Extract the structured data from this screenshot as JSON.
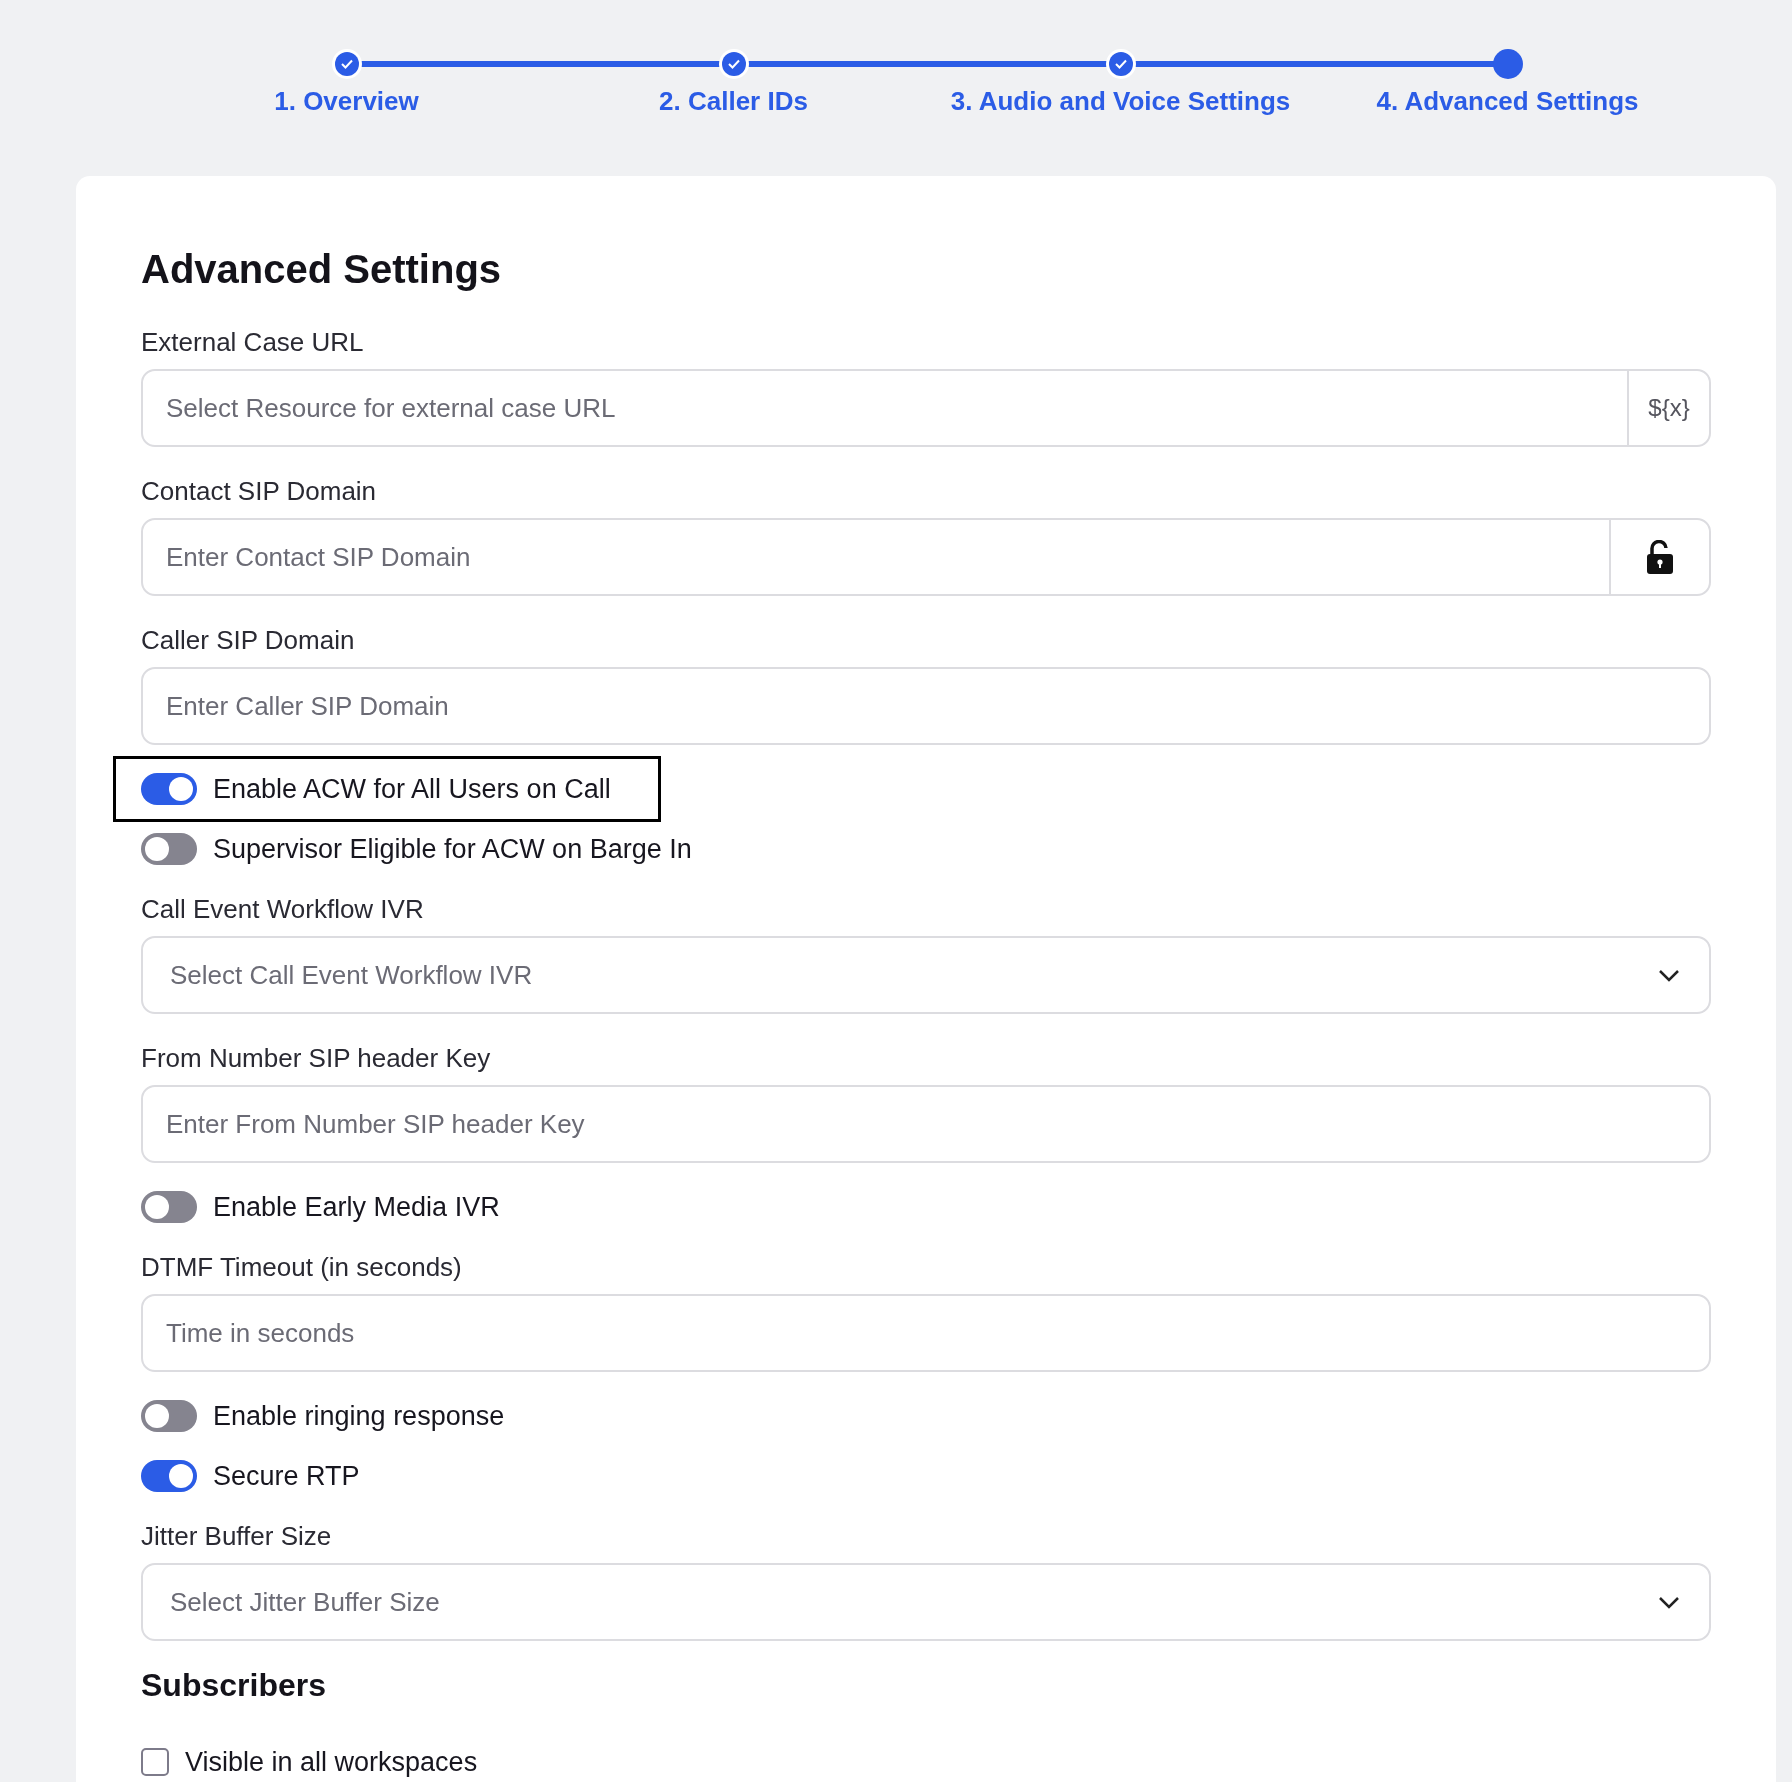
{
  "steps": [
    {
      "label": "1. Overview",
      "done": true,
      "selected": false
    },
    {
      "label": "2. Caller IDs",
      "done": true,
      "selected": false
    },
    {
      "label": "3. Audio and Voice Settings",
      "done": true,
      "selected": false
    },
    {
      "label": "4. Advanced Settings",
      "done": false,
      "selected": true
    }
  ],
  "title": "Advanced Settings",
  "fields": [
    {
      "kind": "text",
      "label": "External Case URL",
      "placeholder": "Select Resource for external case URL",
      "addon": "${x}"
    },
    {
      "kind": "lock",
      "label": "Contact SIP Domain",
      "placeholder": "Enter Contact SIP Domain"
    },
    {
      "kind": "text",
      "label": "Caller SIP Domain",
      "placeholder": "Enter Caller SIP Domain"
    },
    {
      "kind": "toggle",
      "label": "Enable ACW for All Users on Call",
      "on": true,
      "focused": true
    },
    {
      "kind": "toggle",
      "label": "Supervisor Eligible for ACW on Barge In",
      "on": false,
      "focused": false
    },
    {
      "kind": "select",
      "label": "Call Event Workflow IVR",
      "placeholder": "Select Call Event Workflow IVR"
    },
    {
      "kind": "text",
      "label": "From Number SIP header Key",
      "placeholder": "Enter From Number SIP header Key"
    },
    {
      "kind": "toggle",
      "label": "Enable Early Media IVR",
      "on": false,
      "focused": false
    },
    {
      "kind": "text",
      "label": "DTMF Timeout (in seconds)",
      "placeholder": "Time in seconds"
    },
    {
      "kind": "toggle",
      "label": "Enable ringing response",
      "on": false,
      "focused": false
    },
    {
      "kind": "toggle",
      "label": "Secure RTP",
      "on": true,
      "focused": false
    },
    {
      "kind": "select",
      "label": "Jitter Buffer Size",
      "placeholder": "Select Jitter Buffer Size"
    }
  ],
  "subscribers": {
    "title": "Subscribers",
    "options": [
      {
        "label": "Visible in all workspaces",
        "checked": false
      }
    ]
  }
}
